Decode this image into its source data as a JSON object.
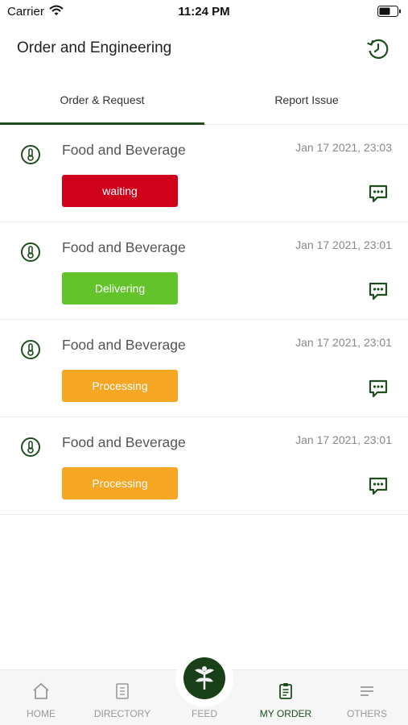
{
  "status_bar": {
    "carrier": "Carrier",
    "time": "11:24 PM"
  },
  "header": {
    "title": "Order and Engineering"
  },
  "tabs": [
    {
      "label": "Order & Request",
      "active": true
    },
    {
      "label": "Report Issue",
      "active": false
    }
  ],
  "orders": [
    {
      "title": "Food and Beverage",
      "datetime": "Jan 17 2021, 23:03",
      "status": "waiting",
      "status_color": "#d0021b"
    },
    {
      "title": "Food and Beverage",
      "datetime": "Jan 17 2021, 23:01",
      "status": "Delivering",
      "status_color": "#62c42a"
    },
    {
      "title": "Food and Beverage",
      "datetime": "Jan 17 2021, 23:01",
      "status": "Processing",
      "status_color": "#f5a623"
    },
    {
      "title": "Food and Beverage",
      "datetime": "Jan 17 2021, 23:01",
      "status": "Processing",
      "status_color": "#f5a623"
    }
  ],
  "bottom_nav": [
    {
      "label": "HOME",
      "icon": "home-icon"
    },
    {
      "label": "DIRECTORY",
      "icon": "directory-icon"
    },
    {
      "label": "FEED",
      "icon": "feed-logo-icon"
    },
    {
      "label": "MY ORDER",
      "icon": "clipboard-icon",
      "active": true
    },
    {
      "label": "OTHERS",
      "icon": "menu-lines-icon"
    }
  ],
  "colors": {
    "brand_green": "#1f4d1f",
    "inactive_gray": "#9a9a9a"
  }
}
